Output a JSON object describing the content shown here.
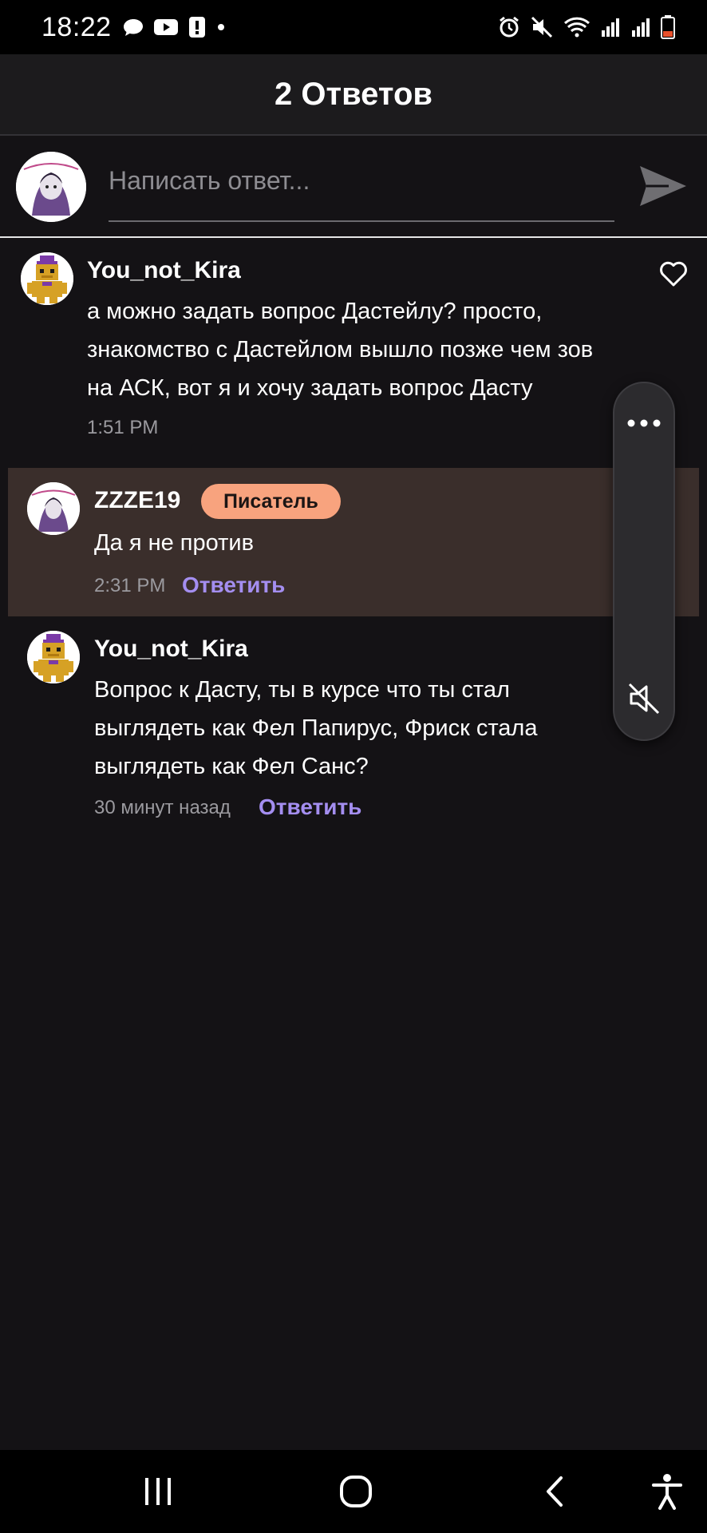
{
  "status_bar": {
    "time": "18:22",
    "left_icons": [
      "chat-bubble-icon",
      "youtube-icon",
      "alert-icon",
      "dot-icon"
    ],
    "right_icons": [
      "alarm-icon",
      "mute-icon",
      "wifi-icon",
      "signal-icon",
      "signal-icon",
      "battery-low-icon"
    ]
  },
  "header": {
    "title": "2 Ответов"
  },
  "compose": {
    "placeholder": "Написать ответ...",
    "value": ""
  },
  "comments": [
    {
      "author": "You_not_Kira",
      "text": "а можно задать вопрос Дастейлу? просто, знакомство с Дастейлом вышло позже чем зов на АСК, вот я и хочу задать вопрос Дасту",
      "time": "1:51 PM"
    },
    {
      "author": "ZZZE19",
      "badge": "Писатель",
      "text": "Да я не против",
      "time": "2:31 PM",
      "reply_label": "Ответить"
    },
    {
      "author": "You_not_Kira",
      "text": "Вопрос к Дасту, ты в курсе что ты стал выглядеть как Фел Папирус,  Фриск стала выглядеть как Фел Санс?",
      "time": "30 минут назад",
      "reply_label": "Ответить"
    }
  ],
  "colors": {
    "accent": "#a48ef0",
    "badge_bg": "#f8a37e",
    "highlight_bg": "#3a2e2b",
    "background": "#141215"
  },
  "floating_panel": {
    "icons": [
      "more-dots-icon",
      "volume-mute-icon"
    ]
  },
  "navbar": {
    "icons": [
      "recent-apps-icon",
      "home-icon",
      "back-icon",
      "accessibility-icon"
    ]
  }
}
